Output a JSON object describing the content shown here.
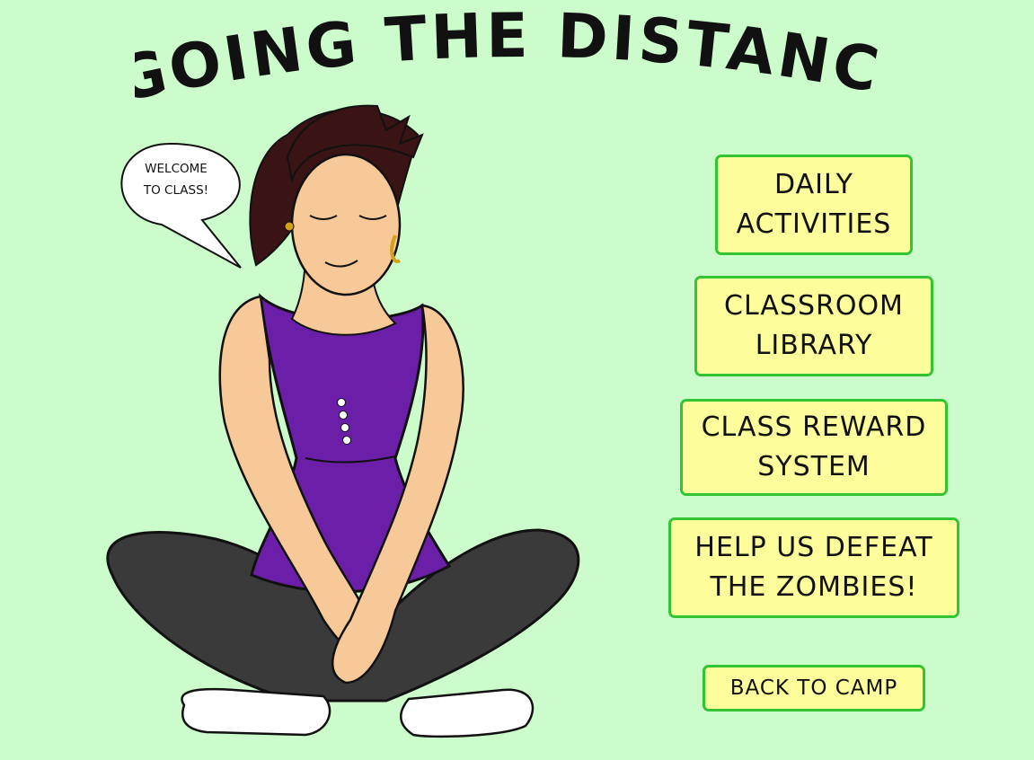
{
  "page": {
    "title": "GOING THE DISTANCE"
  },
  "speech_bubble": {
    "text": "WELCOME\nTO CLASS!"
  },
  "menu": {
    "items": [
      {
        "label": "DAILY\nACTIVITIES"
      },
      {
        "label": "CLASSROOM\nLIBRARY"
      },
      {
        "label": "CLASS REWARD\nSYSTEM"
      },
      {
        "label": "HELP US DEFEAT\nTHE ZOMBIES!"
      }
    ],
    "back_label": "BACK TO CAMP"
  },
  "colors": {
    "background": "#ccfccc",
    "button_fill": "#fdfd9b",
    "button_border": "#33c433",
    "top_color": "#6b1fa8",
    "pants_color": "#3a3a3a",
    "hair_color": "#3a1414",
    "skin_color": "#f7c898"
  },
  "icons": {
    "illustration": "teacher-sitting-cross-legged-illustration",
    "bubble": "speech-bubble-icon"
  }
}
